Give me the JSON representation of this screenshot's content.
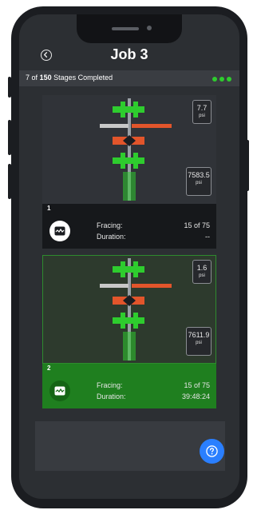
{
  "header": {
    "title": "Job 3"
  },
  "stages": {
    "completed": "7",
    "of_label": "of",
    "total": "150",
    "suffix_label": "Stages Completed"
  },
  "stages_list": [
    {
      "number": "1",
      "psi_top": "7.7",
      "psi_bottom": "7583.5",
      "unit": "psi",
      "status_label": "Fracing:",
      "status_value": "15 of 75",
      "duration_label": "Duration:",
      "duration_value": "--"
    },
    {
      "number": "2",
      "psi_top": "1.6",
      "psi_bottom": "7611.9",
      "unit": "psi",
      "status_label": "Fracing:",
      "status_value": "15 of 75",
      "duration_label": "Duration:",
      "duration_value": "39:48:24"
    }
  ],
  "colors": {
    "accent_green": "#1f7f1f",
    "valve_green": "#2ecc2e",
    "valve_orange": "#e2552b",
    "help_blue": "#2a7fff"
  },
  "icons": {
    "back": "back-arrow-icon",
    "stage": "wave-chart-icon",
    "help": "question-icon"
  }
}
